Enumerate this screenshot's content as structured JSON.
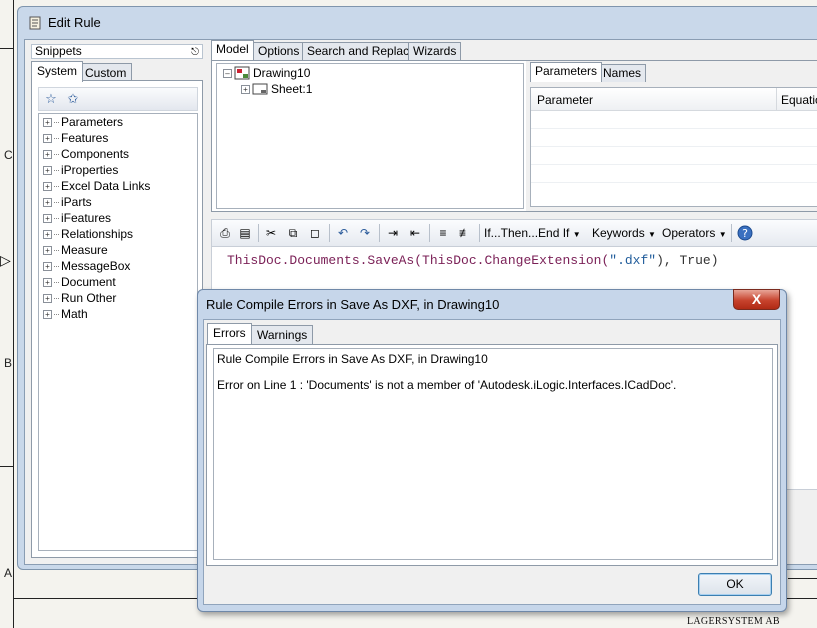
{
  "sheet": {
    "margin_labels": [
      "C",
      "B",
      "A"
    ],
    "company": "LAGERSYSTEM AB"
  },
  "window": {
    "title": "Edit Rule",
    "icon": "scroll-icon"
  },
  "snippets": {
    "header": "Snippets",
    "tabs": [
      "System",
      "Custom"
    ],
    "active_tab": "System",
    "toolbar_icons": [
      "star-filter-icon",
      "star-edit-icon"
    ],
    "items": [
      "Parameters",
      "Features",
      "Components",
      "iProperties",
      "Excel Data Links",
      "iParts",
      "iFeatures",
      "Relationships",
      "Measure",
      "MessageBox",
      "Document",
      "Run Other",
      "Math"
    ]
  },
  "editor_tabs": [
    "Model",
    "Options",
    "Search and Replace",
    "Wizards"
  ],
  "model_tree": {
    "root": "Drawing10",
    "child": "Sheet:1"
  },
  "params": {
    "tabs": [
      "Parameters",
      "Names"
    ],
    "columns": [
      "Parameter",
      "Equatio"
    ]
  },
  "code_toolbar": {
    "if_then": "If...Then...End If",
    "keywords": "Keywords",
    "operators": "Operators",
    "help_icon": "help-icon"
  },
  "code": {
    "part1": "ThisDoc.Documents.SaveAs(",
    "part2": "ThisDoc.ChangeExtension(",
    "part3": "\".dxf\"",
    "part4": "), True)"
  },
  "dialog": {
    "title": "Rule Compile Errors in Save As DXF, in Drawing10",
    "tabs": [
      "Errors",
      "Warnings"
    ],
    "line1": "Rule Compile Errors in Save As DXF, in Drawing10",
    "line2": "Error on Line 1 : 'Documents' is not a member of 'Autodesk.iLogic.Interfaces.ICadDoc'.",
    "ok_label": "OK",
    "close_label": "X"
  }
}
